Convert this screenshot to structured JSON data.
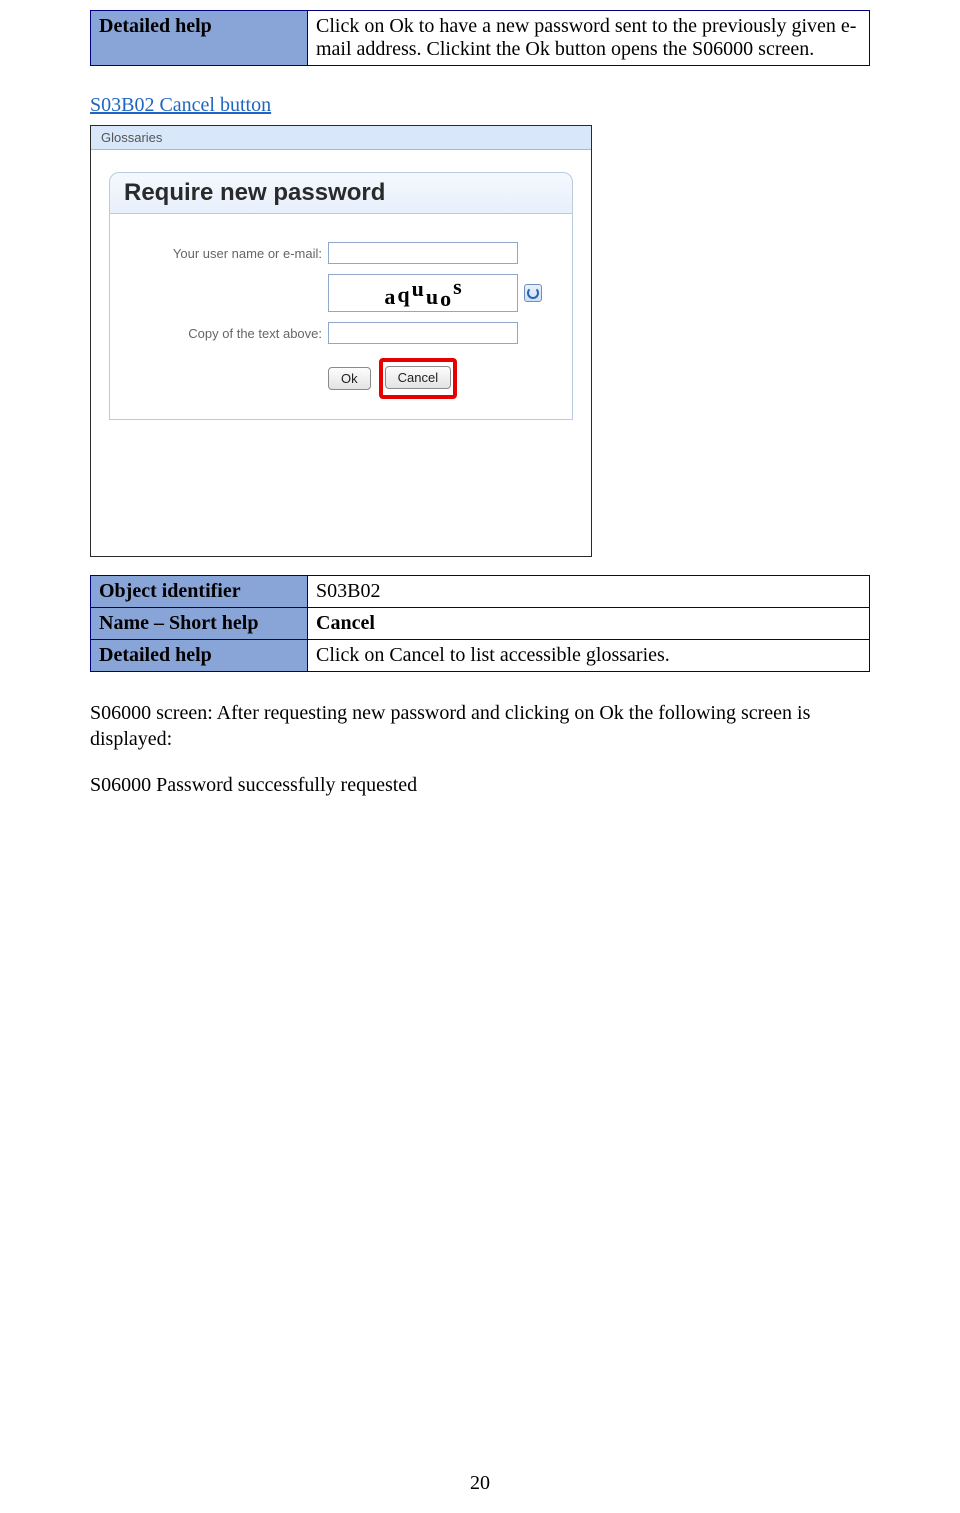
{
  "top_table": {
    "key": "Detailed help",
    "val": "Click on Ok to have a new password sent to the previously given e-mail address. Clickint the Ok button opens the S06000 screen."
  },
  "section_link": "S03B02 Cancel button",
  "screenshot": {
    "titlebar": "Glossaries",
    "panel_title": "Require new password",
    "row_user_label": "Your user name or e-mail:",
    "row_copy_label": "Copy of the text above:",
    "captcha_chars": [
      "a",
      "q",
      "u",
      "u",
      "o",
      "s"
    ],
    "btn_ok": "Ok",
    "btn_cancel": "Cancel"
  },
  "detail_table": {
    "rows": [
      {
        "key": "Object identifier",
        "val": "S03B02"
      },
      {
        "key": "Name – Short help",
        "val": "Cancel"
      },
      {
        "key": "Detailed help",
        "val": "Click on Cancel to list accessible glossaries."
      }
    ]
  },
  "para1": "S06000 screen: After requesting new password and clicking on Ok the following screen is displayed:",
  "para2": "S06000 Password successfully requested",
  "page_number": "20"
}
